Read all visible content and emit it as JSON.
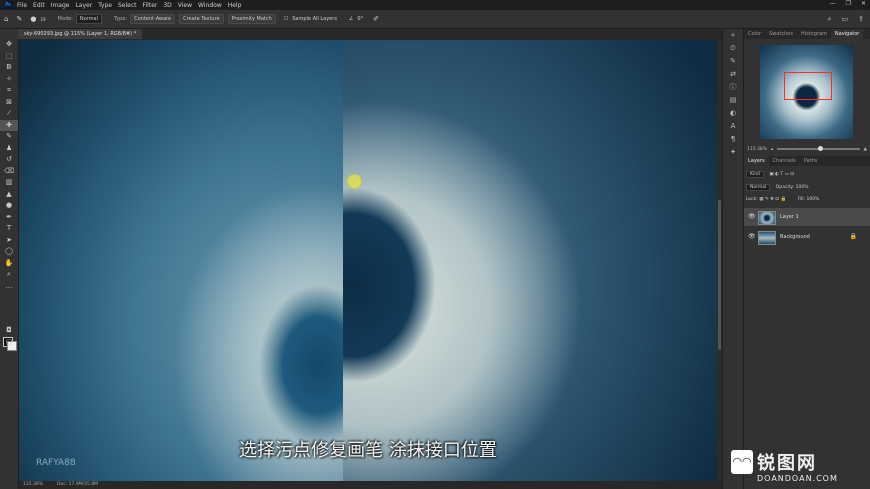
{
  "menubar": {
    "app_logo": "Ps",
    "items": [
      "File",
      "Edit",
      "Image",
      "Layer",
      "Type",
      "Select",
      "Filter",
      "3D",
      "View",
      "Window",
      "Help"
    ],
    "window_controls": [
      "—",
      "❐",
      "✕"
    ]
  },
  "options_bar": {
    "brush_size": "19",
    "mode_label": "Mode:",
    "mode_value": "Normal",
    "type_label": "Type:",
    "type_buttons": [
      "Content-Aware",
      "Create Texture",
      "Proximity Match"
    ],
    "sample_all_layers": "Sample All Layers",
    "angle": "0°"
  },
  "document_tab": "sky-690293.jpg @ 115% (Layer 1, RGB/8#) *",
  "canvas": {
    "subtitle": "选择污点修复画笔 涂抹接口位置",
    "watermark": "RAFYA88"
  },
  "status_bar": {
    "zoom": "115.38%",
    "doc_info": "Doc: 17.9M/35.8M"
  },
  "navigator_panel": {
    "tabs": [
      "Color",
      "Swatches",
      "Histogram",
      "Navigator"
    ],
    "active_tab": "Navigator",
    "zoom": "115.38%"
  },
  "layers_panel": {
    "tabs": [
      "Layers",
      "Channels",
      "Paths"
    ],
    "active_tab": "Layers",
    "filter_kind": "Kind",
    "blend_mode": "Normal",
    "opacity_label": "Opacity:",
    "opacity_value": "100%",
    "lock_label": "Lock:",
    "fill_label": "Fill:",
    "fill_value": "100%",
    "layers": [
      {
        "name": "Layer 1",
        "active": true
      },
      {
        "name": "Background",
        "active": false
      }
    ]
  },
  "corner_logo": {
    "cn": "锐图网",
    "en": "DOANDOAN.COM"
  },
  "colors": {
    "accent": "#31a8ff",
    "panel_bg": "#323232",
    "active_layer_bg": "#4a4a4a",
    "navigator_frame": "#ff2b2b"
  }
}
